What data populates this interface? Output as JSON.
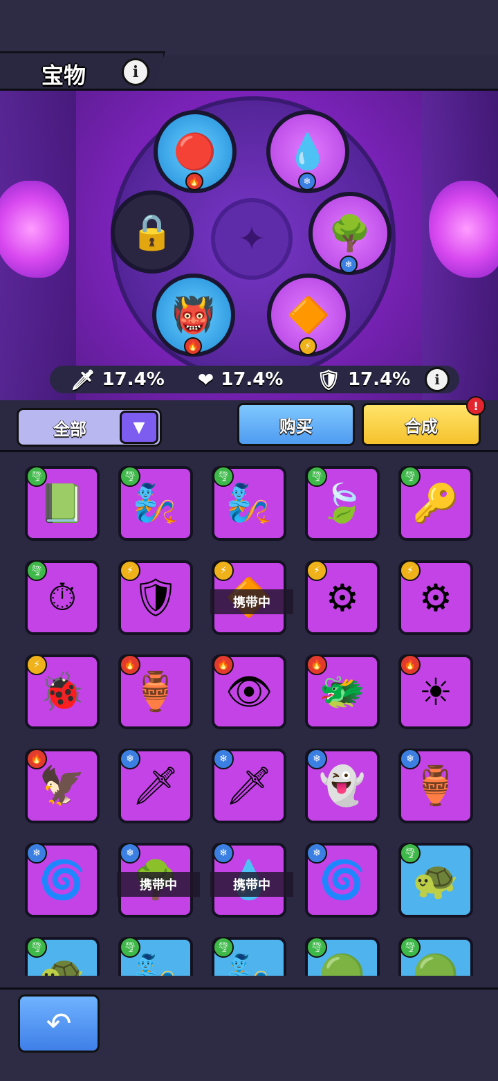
{
  "header": {
    "title": "宝物",
    "info_icon": "info-icon"
  },
  "slots": [
    {
      "name": "fire-orb",
      "element": "fire",
      "icon": "🔴"
    },
    {
      "name": "water-drop",
      "element": "ice",
      "icon": "💧"
    },
    {
      "name": "locked",
      "element": "",
      "icon": "🔒"
    },
    {
      "name": "ice-tree",
      "element": "ice",
      "icon": "🌳"
    },
    {
      "name": "fire-monster-box",
      "element": "fire",
      "icon": "👹"
    },
    {
      "name": "golden-pyramid",
      "element": "bolt",
      "icon": "🔶"
    }
  ],
  "stats": {
    "attack": "17.4%",
    "health": "17.4%",
    "defense": "17.4%"
  },
  "filter": {
    "label": "全部"
  },
  "buttons": {
    "buy": "购买",
    "merge": "合成",
    "merge_alert": "!"
  },
  "carry_label": "携带中",
  "items": [
    {
      "element": "wind",
      "icon": "📗",
      "bg": "purple"
    },
    {
      "element": "wind",
      "icon": "🧞",
      "bg": "purple"
    },
    {
      "element": "wind",
      "icon": "🧞",
      "bg": "purple"
    },
    {
      "element": "wind",
      "icon": "🍃",
      "bg": "purple"
    },
    {
      "element": "wind",
      "icon": "🔑",
      "bg": "purple"
    },
    {
      "element": "wind",
      "icon": "⏱",
      "bg": "purple"
    },
    {
      "element": "bolt",
      "icon": "🛡",
      "bg": "purple"
    },
    {
      "element": "bolt",
      "icon": "🔶",
      "bg": "purple",
      "carried": true
    },
    {
      "element": "bolt",
      "icon": "⚙",
      "bg": "purple"
    },
    {
      "element": "bolt",
      "icon": "⚙",
      "bg": "purple"
    },
    {
      "element": "bolt",
      "icon": "🐞",
      "bg": "purple"
    },
    {
      "element": "fire",
      "icon": "🏺",
      "bg": "purple"
    },
    {
      "element": "fire",
      "icon": "👁",
      "bg": "purple"
    },
    {
      "element": "fire",
      "icon": "🐲",
      "bg": "purple"
    },
    {
      "element": "fire",
      "icon": "☀",
      "bg": "purple"
    },
    {
      "element": "fire",
      "icon": "🦅",
      "bg": "purple"
    },
    {
      "element": "ice",
      "icon": "🗡",
      "bg": "purple"
    },
    {
      "element": "ice",
      "icon": "🗡",
      "bg": "purple"
    },
    {
      "element": "ice",
      "icon": "👻",
      "bg": "purple"
    },
    {
      "element": "ice",
      "icon": "🏺",
      "bg": "purple"
    },
    {
      "element": "ice",
      "icon": "🌀",
      "bg": "purple"
    },
    {
      "element": "ice",
      "icon": "🌳",
      "bg": "purple",
      "carried": true
    },
    {
      "element": "ice",
      "icon": "💧",
      "bg": "purple",
      "carried": true
    },
    {
      "element": "ice",
      "icon": "🌀",
      "bg": "purple"
    },
    {
      "element": "wind",
      "icon": "🐢",
      "bg": "blue"
    },
    {
      "element": "wind",
      "icon": "🐢",
      "bg": "blue"
    },
    {
      "element": "wind",
      "icon": "🧞",
      "bg": "blue"
    },
    {
      "element": "wind",
      "icon": "🧞",
      "bg": "blue"
    },
    {
      "element": "wind",
      "icon": "🟢",
      "bg": "blue"
    },
    {
      "element": "wind",
      "icon": "🟢",
      "bg": "blue"
    }
  ],
  "colors": {
    "fire": "#e23b2e",
    "ice": "#3b7fe2",
    "bolt": "#f0b21a",
    "wind": "#3fb84a"
  },
  "element_glyphs": {
    "fire": "🔥",
    "ice": "❄",
    "bolt": "⚡",
    "wind": "🌪"
  },
  "back_icon": "back-arrow-icon"
}
